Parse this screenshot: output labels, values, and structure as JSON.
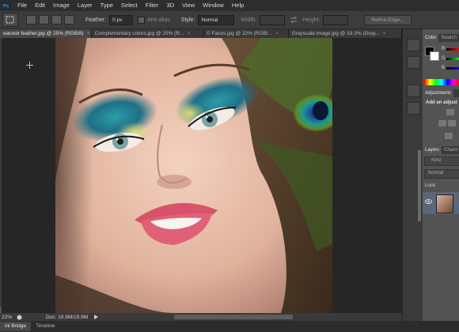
{
  "menu": [
    "File",
    "Edit",
    "Image",
    "Layer",
    "Type",
    "Select",
    "Filter",
    "3D",
    "View",
    "Window",
    "Help"
  ],
  "options": {
    "feather_label": "Feather:",
    "feather_value": "0 px",
    "antialias_label": "Anti-alias",
    "style_label": "Style:",
    "style_value": "Normal",
    "width_label": "Width:",
    "height_label": "Height:",
    "refine_edge": "Refine Edge..."
  },
  "tabs": [
    {
      "label": "eacock feather.jpg @ 25% (RGB/8)",
      "close": "×"
    },
    {
      "label": "Complementary colors.jpg @ 25% (R...",
      "close": "×"
    },
    {
      "label": "© Faces.jpg @ 22% (RGB/...",
      "close": "×"
    },
    {
      "label": "Grayscale image.jpg @ 33.3% (Gray...",
      "close": "×"
    }
  ],
  "status": {
    "zoom": "22%",
    "doc": "Doc: 19.9M/19.9M"
  },
  "bottom_tabs": [
    "ini Bridge",
    "Timeline"
  ],
  "color_panel": {
    "tabs": [
      "Color",
      "Swatch"
    ],
    "channels": [
      "R",
      "G",
      "B"
    ]
  },
  "adjustments_panel": {
    "tab": "Adjustments",
    "add_label": "Add an adjust"
  },
  "layers_panel": {
    "tabs": [
      "Layers",
      "Chann"
    ],
    "kind": "Kind",
    "blend_mode": "Normal",
    "lock_label": "Lock:"
  },
  "colors": {
    "ui_dark": "#2d2d2d",
    "ui_panel": "#535353",
    "canvas_bg": "#262626"
  }
}
